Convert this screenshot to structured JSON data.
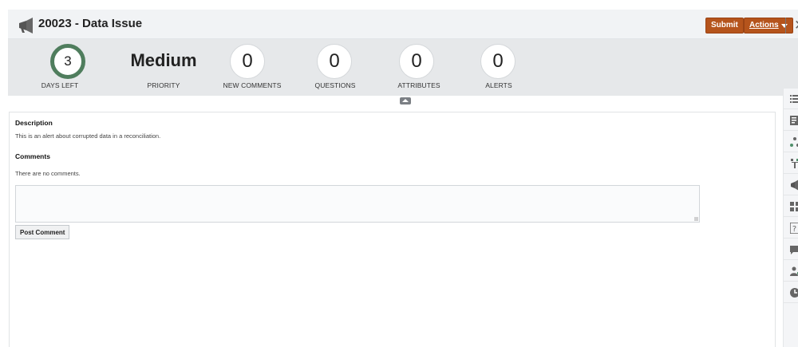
{
  "header": {
    "title": "20023 - Data Issue",
    "title_icon": "megaphone-icon",
    "submit_label": "Submit",
    "actions_label": "Actions",
    "close_icon": "close-icon"
  },
  "stats": {
    "days_left": {
      "value": "3",
      "label": "DAYS LEFT"
    },
    "priority": {
      "value": "Medium",
      "label": "PRIORITY"
    },
    "new_comments": {
      "value": "0",
      "label": "NEW COMMENTS"
    },
    "questions": {
      "value": "0",
      "label": "QUESTIONS"
    },
    "attributes": {
      "value": "0",
      "label": "ATTRIBUTES"
    },
    "alerts": {
      "value": "0",
      "label": "ALERTS"
    }
  },
  "description": {
    "heading": "Description",
    "text": "This is an alert about corrupted data in a reconciliation."
  },
  "comments": {
    "heading": "Comments",
    "empty_text": "There are no comments.",
    "input_value": "",
    "post_label": "Post Comment"
  },
  "rail": {
    "items": [
      "list-icon",
      "document-icon",
      "workflow-icon",
      "hierarchy-icon",
      "megaphone-icon",
      "attributes-icon",
      "question-icon",
      "comment-icon",
      "user-edit-icon",
      "history-icon"
    ]
  },
  "colors": {
    "accent": "#b5541c",
    "ring": "#4f7d5d",
    "stats_bg": "#e6e8ea",
    "header_bg": "#f1f3f5"
  }
}
